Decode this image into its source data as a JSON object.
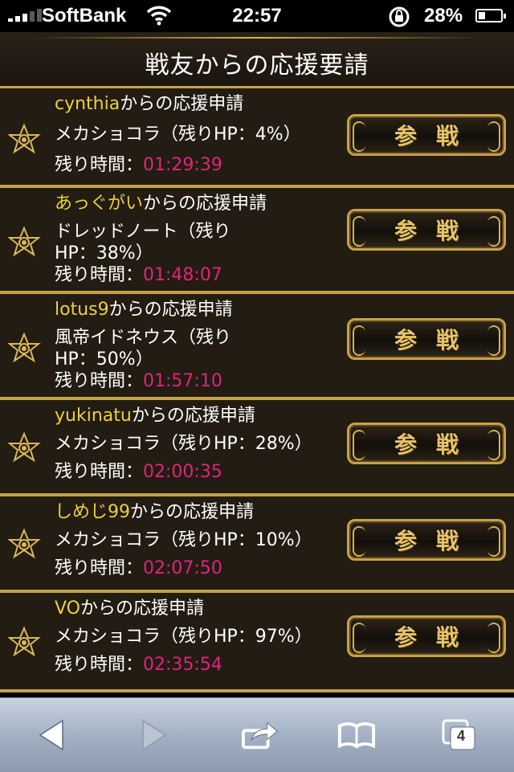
{
  "status_bar": {
    "carrier": "SoftBank",
    "time": "22:57",
    "battery": "28%"
  },
  "header": {
    "title": "戦友からの応援要請"
  },
  "requests": [
    {
      "name": "cynthia",
      "suffix": "からの応援申請",
      "boss_line1": "メカショコラ（残りHP：4%）",
      "boss_line2": "",
      "remain_label": "残り時間：",
      "remain_time": "01:29:39",
      "button": "参戦"
    },
    {
      "name": "あっぐがい",
      "suffix": "からの応援申請",
      "boss_line1": "ドレッドノート（残り",
      "boss_line2": "HP：38%）",
      "remain_label": "残り時間：",
      "remain_time": "01:48:07",
      "button": "参戦"
    },
    {
      "name": "lotus9",
      "suffix": "からの応援申請",
      "boss_line1": "風帝イドネウス（残り",
      "boss_line2": "HP：50%）",
      "remain_label": "残り時間：",
      "remain_time": "01:57:10",
      "button": "参戦"
    },
    {
      "name": "yukinatu",
      "suffix": "からの応援申請",
      "boss_line1": "メカショコラ（残りHP：28%）",
      "boss_line2": "",
      "remain_label": "残り時間：",
      "remain_time": "02:00:35",
      "button": "参戦"
    },
    {
      "name": "しめじ99",
      "suffix": "からの応援申請",
      "boss_line1": "メカショコラ（残りHP：10%）",
      "boss_line2": "",
      "remain_label": "残り時間：",
      "remain_time": "02:07:50",
      "button": "参戦"
    },
    {
      "name": "VO",
      "suffix": "からの応援申請",
      "boss_line1": "メカショコラ（残りHP：97%）",
      "boss_line2": "",
      "remain_label": "残り時間：",
      "remain_time": "02:35:54",
      "button": "参戦"
    }
  ],
  "toolbar": {
    "tab_count": "4"
  }
}
